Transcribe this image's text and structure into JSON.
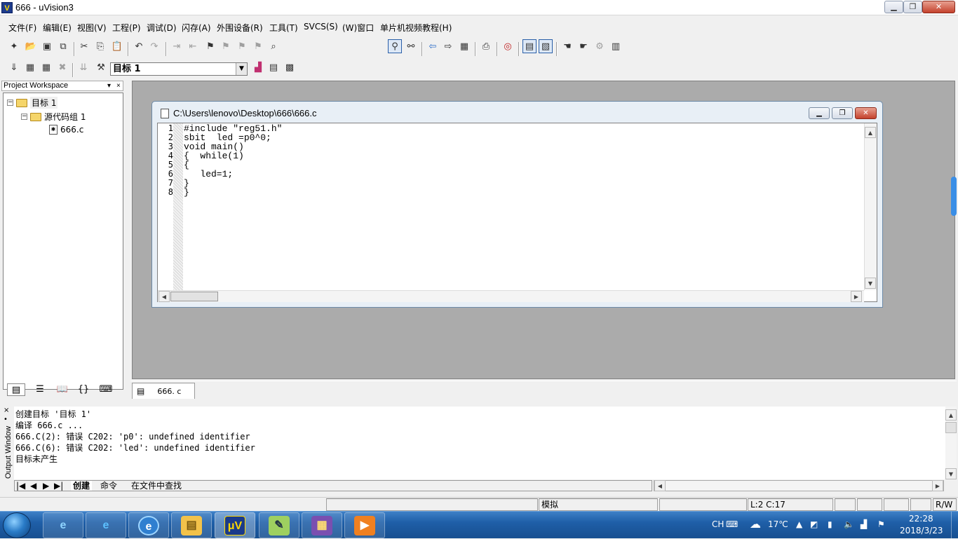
{
  "window": {
    "title": "666  - uVision3",
    "icon": "uv-logo-icon",
    "min_glyph": "▁",
    "max_glyph": "❐",
    "close_glyph": "✕"
  },
  "menu": [
    {
      "label": "文件(F)"
    },
    {
      "label": "编辑(E)"
    },
    {
      "label": "视图(V)"
    },
    {
      "label": "工程(P)"
    },
    {
      "label": "调试(D)"
    },
    {
      "label": "闪存(A)"
    },
    {
      "label": "外围设备(R)"
    },
    {
      "label": "工具(T)"
    },
    {
      "label": "SVCS(S)"
    },
    {
      "label": "(W)窗口"
    },
    {
      "label": "单片机视频教程(H)"
    }
  ],
  "toolbar2": {
    "target_combo": "目标 1"
  },
  "workspace": {
    "header": "Project Workspace",
    "ctl_dropdown": "▾",
    "ctl_close": "×",
    "tree": [
      {
        "label": "目标 1",
        "expander": "−"
      },
      {
        "label": "源代码组 1",
        "expander": "−"
      },
      {
        "label": "666.c"
      }
    ]
  },
  "editor": {
    "title": "C:\\Users\\lenovo\\Desktop\\666\\666.c",
    "min_glyph": "▁",
    "max_glyph": "❐",
    "close_glyph": "✕",
    "line_numbers": [
      "1",
      "2",
      "3",
      "4",
      "5",
      "6",
      "7",
      "8"
    ],
    "lines": [
      "#include \"reg51.h\"",
      "sbit  led =p0^0;",
      "void main()",
      "{  while(1)",
      "{",
      "   led=1;",
      "}",
      "}"
    ]
  },
  "doc_tab": {
    "label": "666. c"
  },
  "output": {
    "side_label": "Output Window",
    "close_glyph": "×",
    "pin_glyph": "•",
    "lines": [
      "创建目标 '目标 1'",
      "编译 666.c ...",
      "666.C(2): 错误 C202: 'p0': undefined identifier",
      "666.C(6): 错误 C202: 'led': undefined identifier",
      "目标未产生"
    ],
    "tabs": [
      {
        "label": "创建"
      },
      {
        "label": "命令"
      },
      {
        "label": "在文件中查找"
      }
    ]
  },
  "status": {
    "mode": "模拟",
    "position": "L:2 C:17",
    "rw": "R/W"
  },
  "taskbar": {
    "tray": {
      "lang": "CH",
      "temp": "17℃",
      "time": "22:28",
      "date": "2018/3/23"
    }
  }
}
